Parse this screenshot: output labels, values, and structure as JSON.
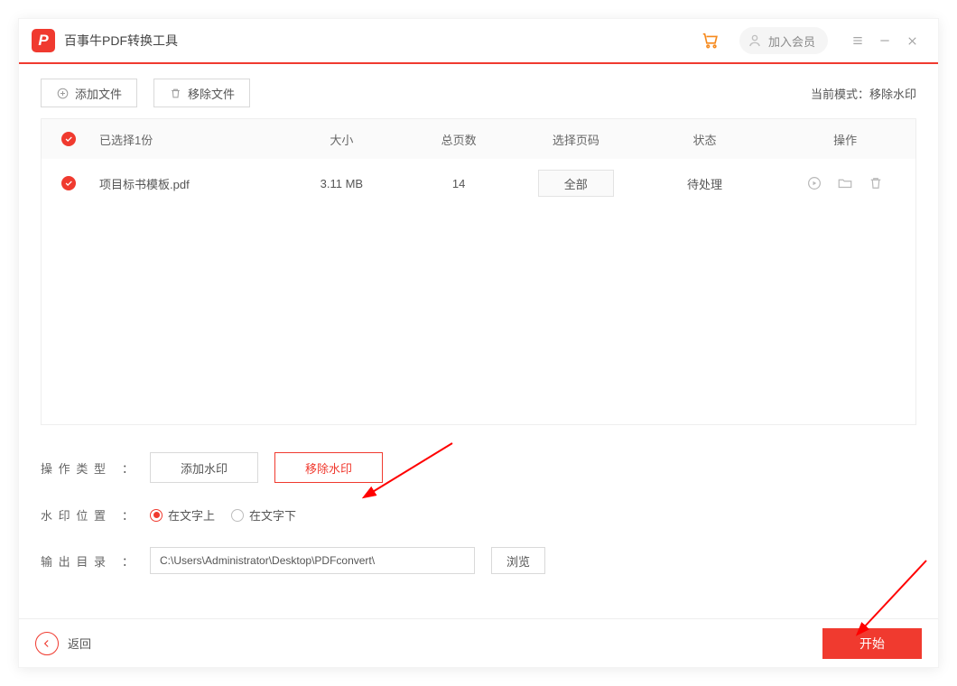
{
  "header": {
    "app_title": "百事牛PDF转换工具",
    "vip_label": "加入会员"
  },
  "toolbar": {
    "add_file": "添加文件",
    "remove_file": "移除文件",
    "mode_text": "当前模式：移除水印"
  },
  "table": {
    "cols": {
      "selected": "已选择1份",
      "size": "大小",
      "pages": "总页数",
      "page_select": "选择页码",
      "status": "状态",
      "actions": "操作"
    },
    "row": {
      "filename": "项目标书模板.pdf",
      "size": "3.11 MB",
      "pages": "14",
      "page_sel": "全部",
      "status": "待处理"
    }
  },
  "options": {
    "op_type_label": "操作类型",
    "add_watermark": "添加水印",
    "remove_watermark": "移除水印",
    "wm_pos_label": "水印位置",
    "pos_above": "在文字上",
    "pos_below": "在文字下",
    "out_dir_label": "输出目录",
    "out_path": "C:\\Users\\Administrator\\Desktop\\PDFconvert\\",
    "browse": "浏览"
  },
  "footer": {
    "back": "返回",
    "start": "开始"
  },
  "colon": "："
}
